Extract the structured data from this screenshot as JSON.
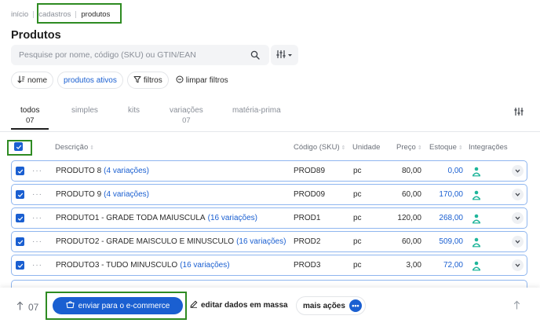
{
  "breadcrumb": {
    "items": [
      "início",
      "cadastros",
      "produtos"
    ]
  },
  "page": {
    "title": "Produtos"
  },
  "search": {
    "placeholder": "Pesquise por nome, código (SKU) ou GTIN/EAN",
    "icon": "search-icon"
  },
  "filters": {
    "sort_label": "nome",
    "status_label": "produtos ativos",
    "filters_label": "filtros",
    "clear_label": "limpar filtros"
  },
  "tabs": [
    {
      "label": "todos",
      "count": "07",
      "active": true
    },
    {
      "label": "simples",
      "count": ""
    },
    {
      "label": "kits",
      "count": ""
    },
    {
      "label": "variações",
      "count": "07"
    },
    {
      "label": "matéria-prima",
      "count": ""
    }
  ],
  "table": {
    "headers": [
      "Descrição",
      "Código (SKU)",
      "Unidade",
      "Preço",
      "Estoque",
      "Integrações"
    ],
    "rows": [
      {
        "name": "PRODUTO 8",
        "variations": "(4 variações)",
        "sku": "PROD89",
        "unit": "pc",
        "price": "80,00",
        "stock": "0,00"
      },
      {
        "name": "PRODUTO 9",
        "variations": "(4 variações)",
        "sku": "PROD09",
        "unit": "pc",
        "price": "60,00",
        "stock": "170,00"
      },
      {
        "name": "PRODUTO1 - GRADE TODA MAIUSCULA",
        "variations": "(16 variações)",
        "sku": "PROD1",
        "unit": "pc",
        "price": "120,00",
        "stock": "268,00"
      },
      {
        "name": "PRODUTO2 - GRADE MAISCULO E MINUSCULO",
        "variations": "(16 variações)",
        "sku": "PROD2",
        "unit": "pc",
        "price": "60,00",
        "stock": "509,00"
      },
      {
        "name": "PRODUTO3 - TUDO MINUSCULO",
        "variations": "(16 variações)",
        "sku": "PROD3",
        "unit": "pc",
        "price": "3,00",
        "stock": "72,00"
      }
    ]
  },
  "bottom_bar": {
    "selected_count": "07",
    "send_label": "enviar para o e-commerce",
    "mass_edit_label": "editar dados em massa",
    "more_actions_label": "mais ações"
  },
  "colors": {
    "accent": "#1a5fd1",
    "highlight": "#2e8b22",
    "integration": "#1fb59a"
  }
}
